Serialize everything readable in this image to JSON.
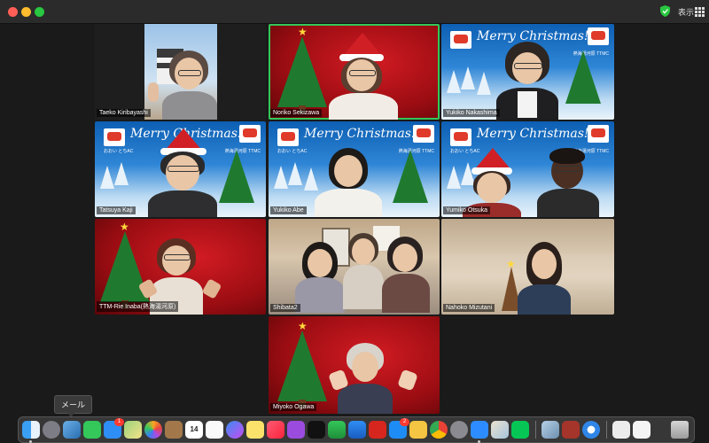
{
  "window": {
    "view_label": "表示"
  },
  "participants": [
    {
      "name": "Taeko Kiribayashi"
    },
    {
      "name": "Noriko Sekizawa"
    },
    {
      "name": "Yukiko Nakashima"
    },
    {
      "name": "Tatsuya Kaji"
    },
    {
      "name": "Yukiko Abe"
    },
    {
      "name": "Yumiko Otsuka"
    },
    {
      "name": "TTM-Rie Inaba(熱海湯河原)"
    },
    {
      "name": "Shibata2"
    },
    {
      "name": "Nahoko Mizutani"
    },
    {
      "name": "Miyoko Ogawa"
    }
  ],
  "background_text": {
    "greeting": "Merry Christmas!",
    "left_caption": "おおい とちAC",
    "right_caption": "熱海湯河原 TTMC"
  },
  "dock": {
    "tooltip": "メール",
    "calendar_day": "14",
    "messages_badge": "1",
    "appstore_badge": "2",
    "apps": [
      "finder",
      "launchpad",
      "preview",
      "facetime",
      "messages",
      "maps",
      "photos",
      "notes-brown",
      "calendar",
      "reminders",
      "messenger",
      "stickies",
      "music",
      "podcasts",
      "tv",
      "numbers",
      "keynote",
      "acrobat",
      "app-store",
      "pencil",
      "chrome",
      "system-preferences",
      "zoom",
      "preview-image",
      "line",
      "photo-library",
      "dictionary",
      "safari",
      "document",
      "file",
      "trash"
    ]
  },
  "colors": {
    "active_speaker": "#34c759",
    "window_bg": "#1a1a1a"
  }
}
